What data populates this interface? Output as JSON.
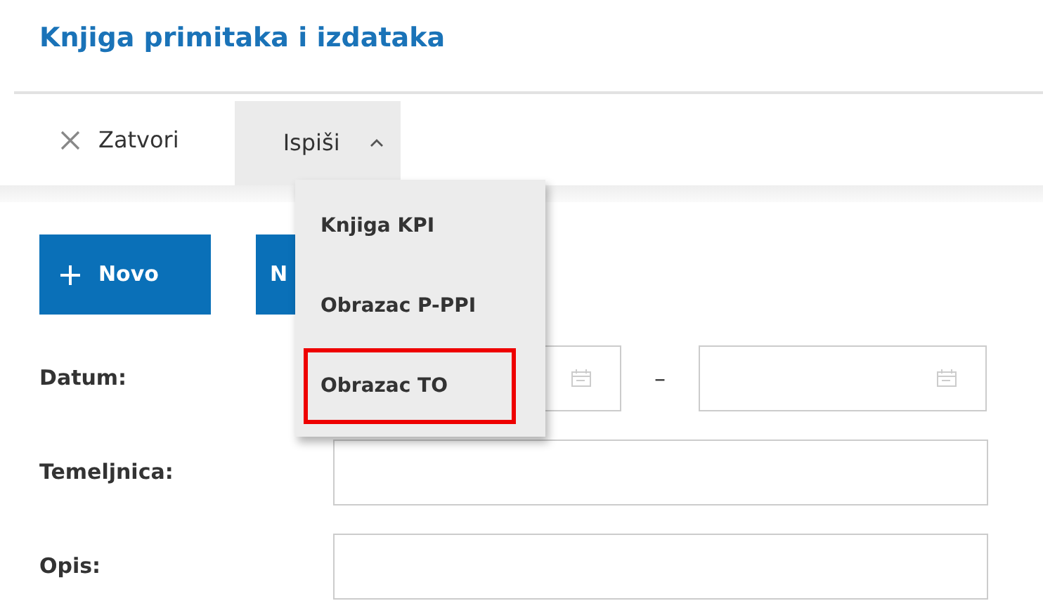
{
  "title": "Knjiga primitaka i izdataka",
  "toolbar": {
    "close": "Zatvori",
    "print": {
      "label": "Ispiši",
      "expanded": true
    }
  },
  "print_menu": [
    {
      "label": "Knjiga KPI",
      "marked": false
    },
    {
      "label": "Obrazac P-PPI",
      "marked": false
    },
    {
      "label": "Obrazac TO",
      "marked": true
    }
  ],
  "buttons": [
    {
      "label": "Novo",
      "kind": "new"
    },
    {
      "label": "N",
      "kind": "plain"
    }
  ],
  "form": [
    {
      "label": "Datum:",
      "kind": "daterange",
      "separator": "–"
    },
    {
      "label": "Temeljnica:",
      "kind": "text"
    },
    {
      "label": "Opis:",
      "kind": "text"
    }
  ]
}
